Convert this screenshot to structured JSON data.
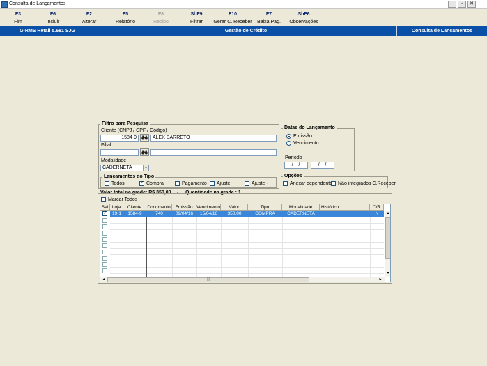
{
  "window": {
    "title": "Consulta de Lançamentos",
    "minimize": "_",
    "maximize": "▫",
    "close": "✕"
  },
  "toolbar": [
    {
      "key": "F3",
      "label": "Fim",
      "enabled": true
    },
    {
      "key": "F6",
      "label": "Incluir",
      "enabled": true
    },
    {
      "key": "F2",
      "label": "Alterar",
      "enabled": true
    },
    {
      "key": "F5",
      "label": "Relatório",
      "enabled": true
    },
    {
      "key": "F8",
      "label": "Recibo",
      "enabled": false
    },
    {
      "key": "ShF9",
      "label": "Filtrar",
      "enabled": true
    },
    {
      "key": "F10",
      "label": "Gerar C. Receber",
      "enabled": true
    },
    {
      "key": "F7",
      "label": "Baixa Pag.",
      "enabled": true
    },
    {
      "key": "ShF6",
      "label": "Observações",
      "enabled": true
    }
  ],
  "header": {
    "left": "G-RMS Retail 5.681 SJG",
    "center": "Gestão de Crédito",
    "right": "Consulta de Lançamentos"
  },
  "filter": {
    "title": "Filtro para Pesquisa",
    "client_label": "Cliente (CNPJ / CPF / Código)",
    "client_code": "1584-9",
    "client_name": "ALEX BARRETO",
    "filial_label": "Filial",
    "filial_code": "",
    "filial_name": "",
    "modalidade_label": "Modalidade",
    "modalidade_value": "CADERNETA",
    "tipos_title": "Lançamentos do Tipo",
    "tipos": [
      {
        "label": "Todos",
        "checked": false
      },
      {
        "label": "Compra",
        "checked": true
      },
      {
        "label": "Pagamento",
        "checked": false
      },
      {
        "label": "Ajuste +",
        "checked": false
      },
      {
        "label": "Ajuste -",
        "checked": false
      }
    ]
  },
  "datas": {
    "title": "Datas do Lançamento",
    "options": [
      {
        "label": "Emissão",
        "selected": true
      },
      {
        "label": "Vencimento",
        "selected": false
      }
    ],
    "periodo_label": "Período",
    "date_from": "__/__/__",
    "date_to": "__/__/__"
  },
  "opcoes": {
    "title": "Opções",
    "items": [
      {
        "label": "Anexar dependentes",
        "checked": false
      },
      {
        "label": "Não integrados C.Receber",
        "checked": false
      }
    ]
  },
  "summary": {
    "total_text": "Valor total na grade: R$ 350,00",
    "separator": "-",
    "qty_text": "Quantidade na grade : 1",
    "mark_all_label": "Marcar Todos"
  },
  "grid": {
    "columns": [
      "Sel",
      "Loja",
      "Cliente",
      "Documento",
      "Emissão",
      "Vencimento",
      "Valor",
      "Tipo",
      "Modalidade",
      "Histórico",
      "C/R"
    ],
    "rows": [
      {
        "sel": "✓",
        "loja": "19-1",
        "cliente": "1584-9",
        "documento": "740",
        "emissao": "09/04/16",
        "vencimento": "15/04/16",
        "valor": "350,00",
        "tipo": "COMPRA",
        "modalidade": "CADERNETA",
        "historico": "",
        "cr": "N"
      }
    ],
    "scroll_left": "◂",
    "scroll_right": "▸",
    "scroll_up": "▴",
    "scroll_down": "▾",
    "scroll_thumb": "|||"
  },
  "icons": {
    "binoculars": "binoculars-icon",
    "check": "✓",
    "dropdown": "▼"
  },
  "colors": {
    "header_blue": "#0a50a6",
    "selected_row": "#3a86d9",
    "key_text": "#0a246a"
  }
}
